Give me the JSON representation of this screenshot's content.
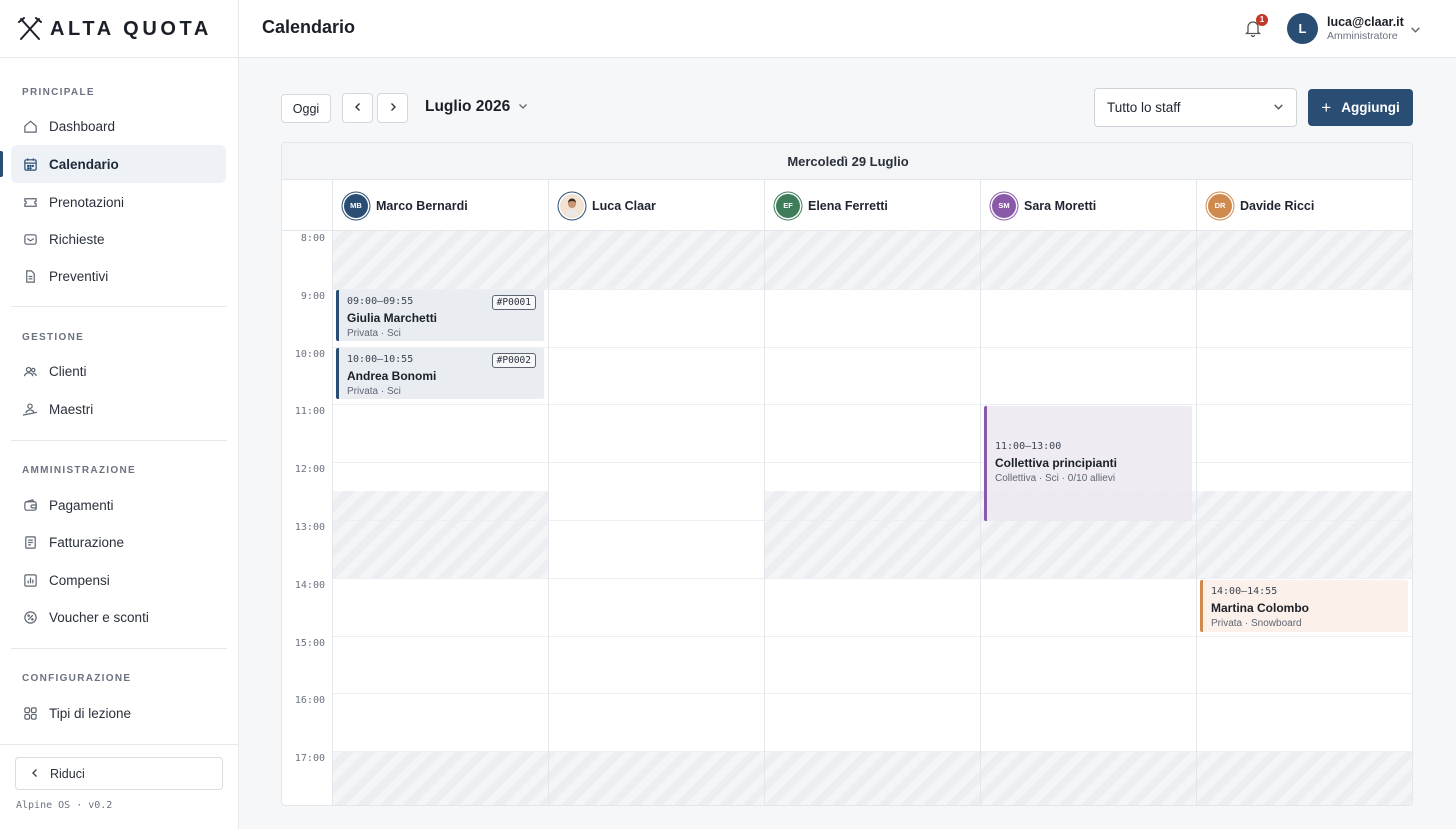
{
  "app": {
    "logo_text": "ALTA QUOTA",
    "version": "Alpine OS · v0.2"
  },
  "sidebar": {
    "sections": [
      {
        "label": "PRINCIPALE",
        "items": [
          {
            "label": "Dashboard",
            "icon": "home-icon"
          },
          {
            "label": "Calendario",
            "icon": "calendar-icon",
            "active": true
          },
          {
            "label": "Prenotazioni",
            "icon": "ticket-icon"
          },
          {
            "label": "Richieste",
            "icon": "inbox-icon"
          },
          {
            "label": "Preventivi",
            "icon": "document-icon"
          }
        ]
      },
      {
        "label": "GESTIONE",
        "items": [
          {
            "label": "Clienti",
            "icon": "users-icon"
          },
          {
            "label": "Maestri",
            "icon": "instructor-icon"
          }
        ]
      },
      {
        "label": "AMMINISTRAZIONE",
        "items": [
          {
            "label": "Pagamenti",
            "icon": "wallet-icon"
          },
          {
            "label": "Fatturazione",
            "icon": "invoice-icon"
          },
          {
            "label": "Compensi",
            "icon": "bar-chart-icon"
          },
          {
            "label": "Voucher e sconti",
            "icon": "discount-icon"
          }
        ]
      },
      {
        "label": "CONFIGURAZIONE",
        "items": [
          {
            "label": "Tipi di lezione",
            "icon": "grid-icon"
          }
        ]
      }
    ],
    "collapse_label": "Riduci"
  },
  "header": {
    "title": "Calendario",
    "notifications_count": "1",
    "user_initial": "L",
    "user_email": "luca@claar.it",
    "user_role": "Amministratore"
  },
  "toolbar": {
    "today_label": "Oggi",
    "month_label": "Luglio 2026",
    "staff_filter": "Tutto lo staff",
    "add_label": "Aggiungi"
  },
  "calendar": {
    "day_label": "Mercoledì 29 Luglio",
    "staff": [
      {
        "name": "Marco Bernardi",
        "initials": "MB",
        "color": "#2a4d74"
      },
      {
        "name": "Luca Claar",
        "initials": "",
        "color": "#2a4d74"
      },
      {
        "name": "Elena Ferretti",
        "initials": "EF",
        "color": "#3f7d5a"
      },
      {
        "name": "Sara Moretti",
        "initials": "SM",
        "color": "#8a5aa8"
      },
      {
        "name": "Davide Ricci",
        "initials": "DR",
        "color": "#d08a4e"
      }
    ],
    "hours": [
      "8:00",
      "9:00",
      "10:00",
      "11:00",
      "12:00",
      "13:00",
      "14:00",
      "15:00",
      "16:00",
      "17:00"
    ],
    "events": [
      {
        "time": "09:00–09:55",
        "title": "Giulia Marchetti",
        "sub": "Privata · Sci",
        "code": "#P0001"
      },
      {
        "time": "10:00–10:55",
        "title": "Andrea Bonomi",
        "sub": "Privata · Sci",
        "code": "#P0002"
      },
      {
        "time": "11:00–13:00",
        "title": "Collettiva principianti",
        "sub": "Collettiva · Sci · 0/10 allievi"
      },
      {
        "time": "14:00–14:55",
        "title": "Martina Colombo",
        "sub": "Privata · Snowboard"
      }
    ]
  }
}
